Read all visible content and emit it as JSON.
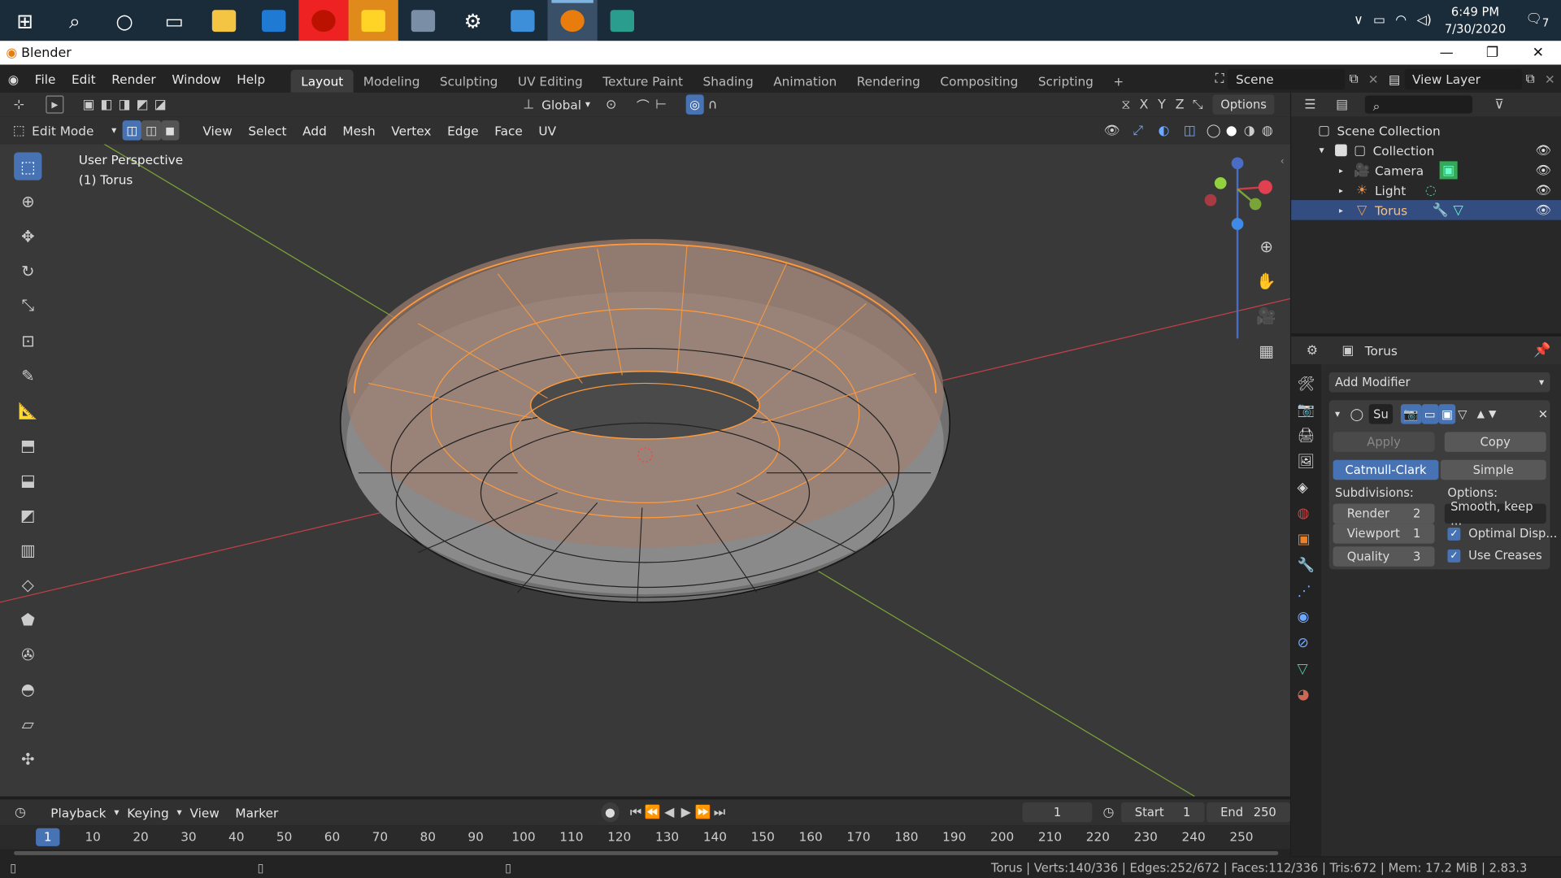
{
  "taskbar": {
    "time": "6:49 PM",
    "date": "7/30/2020",
    "notifications": "7"
  },
  "window": {
    "title": "Blender"
  },
  "menu": [
    "File",
    "Edit",
    "Render",
    "Window",
    "Help"
  ],
  "workspaces": [
    "Layout",
    "Modeling",
    "Sculpting",
    "UV Editing",
    "Texture Paint",
    "Shading",
    "Animation",
    "Rendering",
    "Compositing",
    "Scripting"
  ],
  "scene": {
    "label": "Scene",
    "view_layer": "View Layer"
  },
  "viewport": {
    "transform_orientation": "Global",
    "options_label": "Options",
    "mode": "Edit Mode",
    "header_menus": [
      "View",
      "Select",
      "Add",
      "Mesh",
      "Vertex",
      "Edge",
      "Face",
      "UV"
    ],
    "perspective": "User Perspective",
    "object_info": "(1) Torus",
    "axes": {
      "x": "X",
      "y": "Y",
      "z": "Z"
    }
  },
  "outliner": {
    "root": "Scene Collection",
    "collection": "Collection",
    "items": [
      "Camera",
      "Light",
      "Torus"
    ]
  },
  "properties": {
    "object_name": "Torus",
    "add_modifier": "Add Modifier",
    "modifier_name": "Su",
    "apply": "Apply",
    "copy": "Copy",
    "catmull": "Catmull-Clark",
    "simple": "Simple",
    "subdivisions_label": "Subdivisions:",
    "options_label": "Options:",
    "render_label": "Render",
    "render_value": "2",
    "viewport_label": "Viewport",
    "viewport_value": "1",
    "quality_label": "Quality",
    "quality_value": "3",
    "uv_smooth": "Smooth, keep ...",
    "optimal_display": "Optimal Disp...",
    "use_creases": "Use Creases"
  },
  "timeline": {
    "playback": "Playback",
    "keying": "Keying",
    "view": "View",
    "marker": "Marker",
    "current_frame": "1",
    "start_label": "Start",
    "start_value": "1",
    "end_label": "End",
    "end_value": "250",
    "ticks": [
      "10",
      "20",
      "30",
      "40",
      "50",
      "60",
      "70",
      "80",
      "90",
      "100",
      "110",
      "120",
      "130",
      "140",
      "150",
      "160",
      "170",
      "180",
      "190",
      "200",
      "210",
      "220",
      "230",
      "240",
      "250"
    ],
    "cursor_frame": "1"
  },
  "status": {
    "text": "Torus | Verts:140/336 | Edges:252/672 | Faces:112/336 | Tris:672 | Mem: 17.2 MiB | 2.83.3"
  },
  "colors": {
    "accent": "#4772b3",
    "selection": "#ff9a3c",
    "x_axis": "#c4404a",
    "y_axis": "#7aa437"
  }
}
